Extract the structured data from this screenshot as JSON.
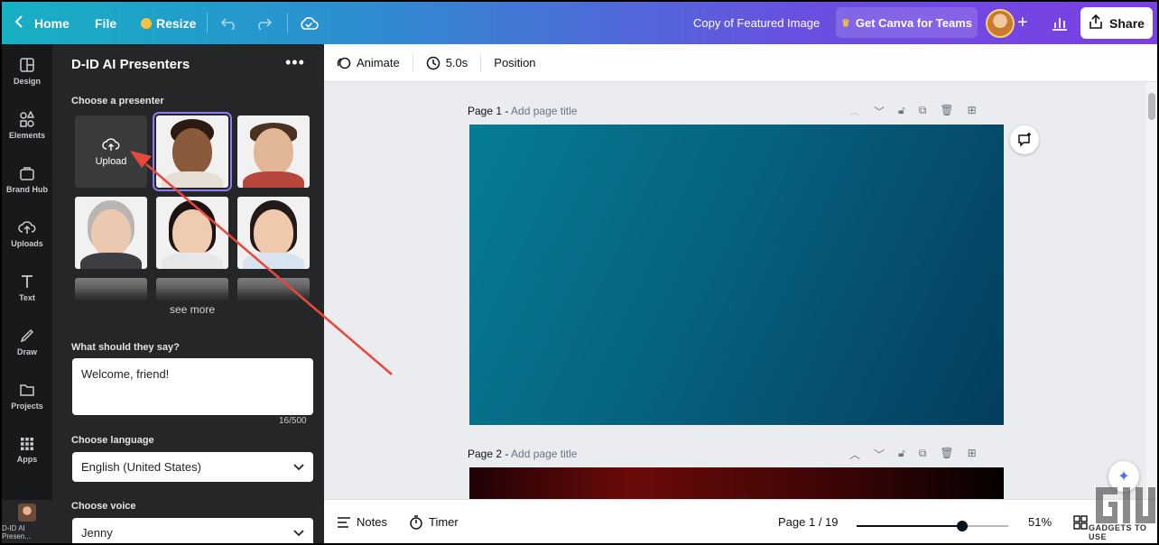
{
  "topbar": {
    "home_label": "Home",
    "file_label": "File",
    "resize_label": "Resize",
    "doc_title": "Copy of Featured Image",
    "teams_label": "Get Canva for Teams",
    "share_label": "Share"
  },
  "rail": {
    "items": [
      {
        "label": "Design",
        "icon": "design-icon"
      },
      {
        "label": "Elements",
        "icon": "elements-icon"
      },
      {
        "label": "Brand Hub",
        "icon": "brand-hub-icon"
      },
      {
        "label": "Uploads",
        "icon": "upload-cloud-icon"
      },
      {
        "label": "Text",
        "icon": "text-icon"
      },
      {
        "label": "Draw",
        "icon": "draw-icon"
      },
      {
        "label": "Projects",
        "icon": "folder-icon"
      },
      {
        "label": "Apps",
        "icon": "apps-grid-icon"
      }
    ],
    "active_app_label": "D-ID AI Presen..."
  },
  "panel": {
    "title": "D-ID AI Presenters",
    "choose_presenter": "Choose a presenter",
    "upload_label": "Upload",
    "see_more": "see more",
    "say_label": "What should they say?",
    "script_text": "Welcome, friend!",
    "char_count": "16/500",
    "language_label": "Choose language",
    "language_value": "English (United States)",
    "voice_label": "Choose voice",
    "voice_value": "Jenny"
  },
  "toolbar": {
    "animate_label": "Animate",
    "duration_label": "5.0s",
    "position_label": "Position"
  },
  "pages": [
    {
      "label": "Page 1 -",
      "title_placeholder": "Add page title"
    },
    {
      "label": "Page 2 -",
      "title_placeholder": "Add page title"
    }
  ],
  "bottombar": {
    "notes_label": "Notes",
    "timer_label": "Timer",
    "page_indicator": "Page 1 / 19",
    "zoom_level": "51%",
    "zoom_fraction": 0.51
  },
  "watermark_text": "GADGETS TO USE",
  "colors": {
    "topbar_gradient_start": "#16b0c4",
    "topbar_gradient_end": "#7b3fe4",
    "panel_bg": "#252627",
    "rail_bg": "#18191b",
    "selection_outline": "#8b7cf6",
    "annotation_arrow": "#e8483c"
  }
}
